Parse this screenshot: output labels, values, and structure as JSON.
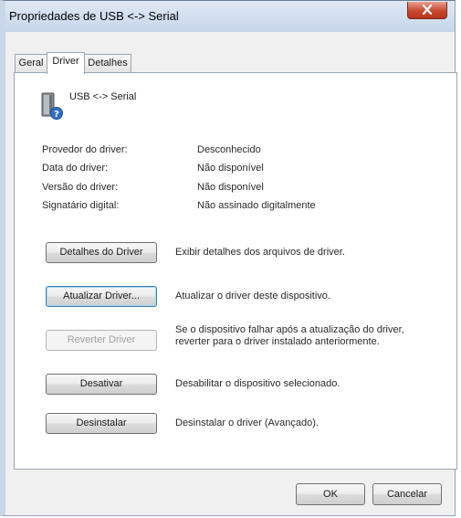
{
  "window": {
    "title": "Propriedades de USB <-> Serial",
    "close_icon": "close-icon"
  },
  "tabs": [
    {
      "label": "Geral",
      "active": false
    },
    {
      "label": "Driver",
      "active": true
    },
    {
      "label": "Detalhes",
      "active": false
    }
  ],
  "device": {
    "name": "USB <-> Serial",
    "icon": "usb-device-unknown-icon"
  },
  "info": [
    {
      "label": "Provedor do driver:",
      "value": "Desconhecido"
    },
    {
      "label": "Data do driver:",
      "value": "Não disponível"
    },
    {
      "label": "Versão do driver:",
      "value": "Não disponível"
    },
    {
      "label": "Signatário digital:",
      "value": "Não assinado digitalmente"
    }
  ],
  "actions": [
    {
      "label": "Detalhes do Driver",
      "description": "Exibir detalhes dos arquivos de driver.",
      "enabled": true
    },
    {
      "label": "Atualizar Driver...",
      "description": "Atualizar o driver deste dispositivo.",
      "enabled": true
    },
    {
      "label": "Reverter Driver",
      "description": "Se o dispositivo falhar após a atualização do driver, reverter para o driver instalado anteriormente.",
      "enabled": false
    },
    {
      "label": "Desativar",
      "description": "Desabilitar o dispositivo selecionado.",
      "enabled": true
    },
    {
      "label": "Desinstalar",
      "description": "Desinstalar o driver (Avançado).",
      "enabled": true
    }
  ],
  "footer": {
    "ok_label": "OK",
    "cancel_label": "Cancelar"
  },
  "colors": {
    "close_button": "#c9462e",
    "focus_border": "#3c7fb1"
  }
}
